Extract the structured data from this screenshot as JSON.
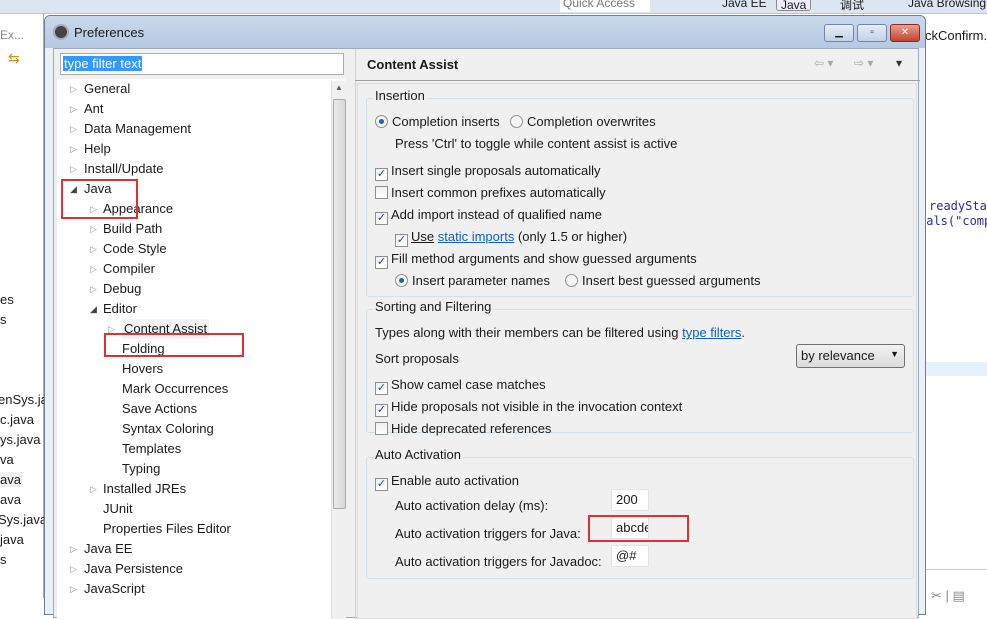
{
  "background": {
    "toolbar": {
      "quick_access": "Quick Access",
      "perspectives": [
        "Java EE",
        "Java",
        "调试",
        "Java Browsing"
      ]
    },
    "left_fragments": [
      "Ex...",
      "es",
      "s",
      "enSys.java",
      "c.java",
      "ys.java",
      "va",
      "ava",
      "ava",
      "Sys.java",
      "java",
      "s"
    ],
    "right_fragments": [
      "ckConfirm.j",
      "readySta",
      "uals(\"comp"
    ]
  },
  "dialog": {
    "title": "Preferences",
    "filter_placeholder": "type filter text",
    "tree": [
      {
        "label": "General",
        "level": 0,
        "arrow": "collapsed"
      },
      {
        "label": "Ant",
        "level": 0,
        "arrow": "collapsed"
      },
      {
        "label": "Data Management",
        "level": 0,
        "arrow": "collapsed"
      },
      {
        "label": "Help",
        "level": 0,
        "arrow": "collapsed"
      },
      {
        "label": "Install/Update",
        "level": 0,
        "arrow": "collapsed"
      },
      {
        "label": "Java",
        "level": 0,
        "arrow": "expanded"
      },
      {
        "label": "Appearance",
        "level": 1,
        "arrow": "collapsed"
      },
      {
        "label": "Build Path",
        "level": 1,
        "arrow": "collapsed"
      },
      {
        "label": "Code Style",
        "level": 1,
        "arrow": "collapsed"
      },
      {
        "label": "Compiler",
        "level": 1,
        "arrow": "collapsed"
      },
      {
        "label": "Debug",
        "level": 1,
        "arrow": "collapsed"
      },
      {
        "label": "Editor",
        "level": 1,
        "arrow": "expanded"
      },
      {
        "label": "Content Assist",
        "level": 2,
        "arrow": "collapsed",
        "selected": true
      },
      {
        "label": "Folding",
        "level": 2,
        "arrow": "none"
      },
      {
        "label": "Hovers",
        "level": 2,
        "arrow": "none"
      },
      {
        "label": "Mark Occurrences",
        "level": 2,
        "arrow": "none"
      },
      {
        "label": "Save Actions",
        "level": 2,
        "arrow": "none"
      },
      {
        "label": "Syntax Coloring",
        "level": 2,
        "arrow": "none"
      },
      {
        "label": "Templates",
        "level": 2,
        "arrow": "none"
      },
      {
        "label": "Typing",
        "level": 2,
        "arrow": "none"
      },
      {
        "label": "Installed JREs",
        "level": 1,
        "arrow": "collapsed"
      },
      {
        "label": "JUnit",
        "level": 1,
        "arrow": "none"
      },
      {
        "label": "Properties Files Editor",
        "level": 1,
        "arrow": "none"
      },
      {
        "label": "Java EE",
        "level": 0,
        "arrow": "collapsed"
      },
      {
        "label": "Java Persistence",
        "level": 0,
        "arrow": "collapsed"
      },
      {
        "label": "JavaScript",
        "level": 0,
        "arrow": "collapsed"
      }
    ],
    "page_title": "Content Assist",
    "insertion": {
      "legend": "Insertion",
      "completion_inserts": "Completion inserts",
      "completion_overwrites": "Completion overwrites",
      "toggle_hint": "Press 'Ctrl' to toggle while content assist is active",
      "single_proposals": "Insert single proposals automatically",
      "common_prefixes": "Insert common prefixes automatically",
      "add_import": "Add import instead of qualified name",
      "use_label": "Use",
      "static_imports_link": "static imports",
      "static_imports_suffix": "(only 1.5 or higher)",
      "fill_args": "Fill method arguments and show guessed arguments",
      "param_names": "Insert parameter names",
      "best_guessed": "Insert best guessed arguments"
    },
    "sorting": {
      "legend": "Sorting and Filtering",
      "types_text": "Types along with their members can be filtered using",
      "type_filters_link": "type filters",
      "period": ".",
      "sort_label": "Sort proposals",
      "sort_value": "by relevance",
      "camel_case": "Show camel case matches",
      "hide_not_visible": "Hide proposals not visible in the invocation context",
      "hide_deprecated": "Hide deprecated references"
    },
    "auto": {
      "legend": "Auto Activation",
      "enable": "Enable auto activation",
      "delay_label": "Auto activation delay (ms):",
      "delay_value": "200",
      "java_label": "Auto activation triggers for Java:",
      "java_value": "abcde",
      "javadoc_label": "Auto activation triggers for Javadoc:",
      "javadoc_value": "@#"
    },
    "highlight_color": "#e03030"
  }
}
